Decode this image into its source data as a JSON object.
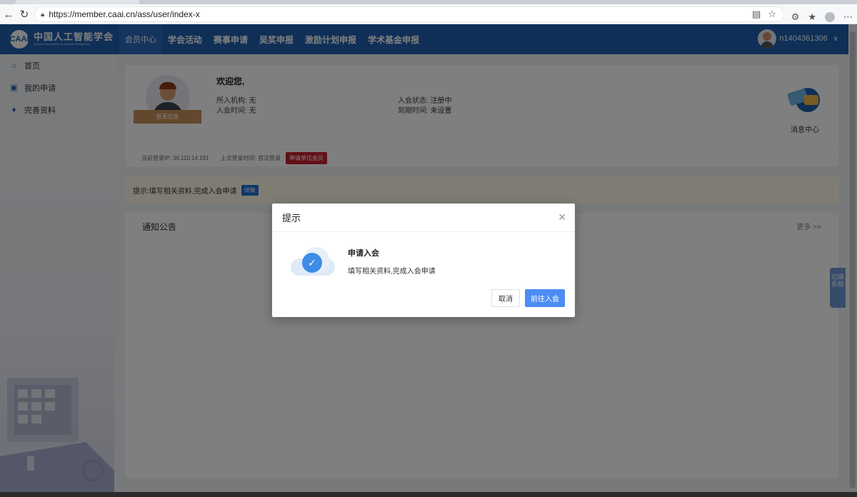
{
  "browser": {
    "url": "https://member.caai.cn/ass/user/index-x"
  },
  "header": {
    "logo_mark": "CAAI",
    "logo_cn": "中国人工智能学会",
    "logo_en": "Chinese Association for Artificial Intelligence",
    "nav": [
      "会员中心",
      "学会活动",
      "赛事申请",
      "吴奖申报",
      "激励计划申报",
      "学术基金申报"
    ],
    "username": "n1404361306"
  },
  "sidebar": {
    "items": [
      {
        "label": "首页",
        "icon": "home-icon"
      },
      {
        "label": "我的申请",
        "icon": "file-icon"
      },
      {
        "label": "完善资料",
        "icon": "drop-icon"
      }
    ]
  },
  "profile": {
    "photo_label": "暂无信息",
    "welcome": "欢迎您,",
    "org_label": "所入机构:",
    "org_value": "无",
    "join_time_label": "入会时间:",
    "join_time_value": "无",
    "status_label": "入会状态:",
    "status_value": "注册中",
    "expire_label": "到期时间:",
    "expire_value": "未设置",
    "message_center": "消息中心",
    "current_ip_label": "当前登录IP:",
    "current_ip": "36.110.14.191",
    "last_login_label": "上次登录时间:",
    "last_login": "首次登录",
    "apply_button": "申请单位会员"
  },
  "hint": {
    "text": "提示:填写相关资料,完成入会申请",
    "detail": "详情"
  },
  "notice": {
    "title": "通知公告",
    "more": "更多 >>"
  },
  "switch_tab": "切换系统",
  "modal": {
    "title": "提示",
    "heading": "申请入会",
    "text": "填写相关资料,完成入会申请",
    "cancel": "取消",
    "confirm": "前往入会"
  }
}
